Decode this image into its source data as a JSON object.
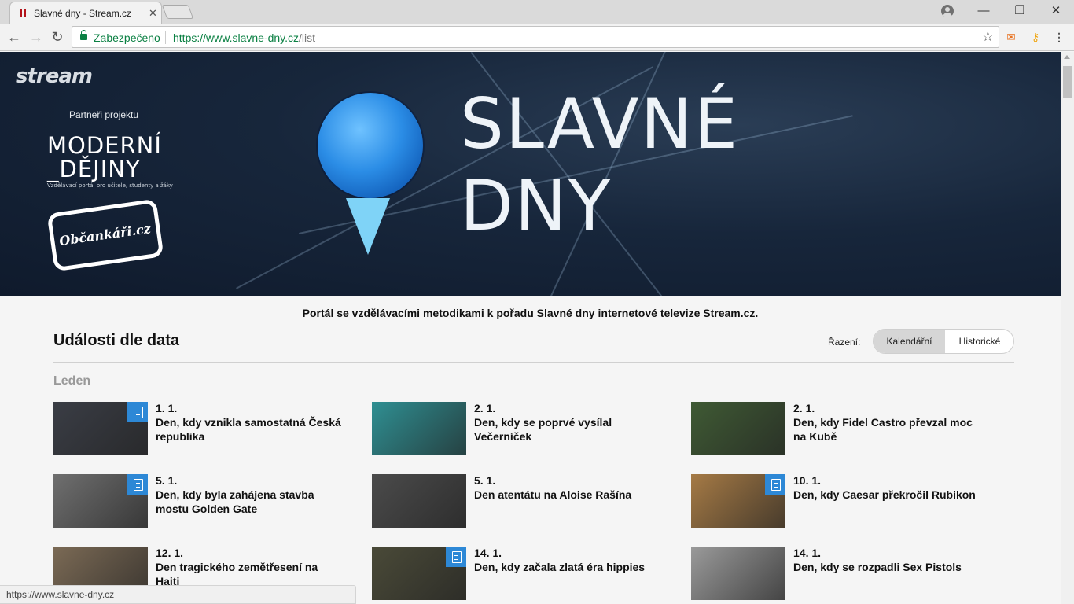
{
  "browser": {
    "tab_title": "Slavné dny - Stream.cz",
    "secure_label": "Zabezpečeno",
    "url_host": "https://www.slavne-dny.cz",
    "url_path": "/list",
    "status_url": "https://www.slavne-dny.cz"
  },
  "hero": {
    "brand": "stream",
    "partners_label": "Partneři projektu",
    "partner1_line1": "MODERNÍ",
    "partner1_line2": "_DĚJINY",
    "partner1_tagline": "Vzdělávací portál pro učitele, studenty a žáky",
    "partner2": "Občankáři.cz",
    "title_line1": "SLAVNÉ",
    "title_line2": "DNY"
  },
  "page": {
    "tagline": "Portál se vzdělávacími metodikami k pořadu Slavné dny internetové televize Stream.cz.",
    "section_title": "Události dle data",
    "sort_label": "Řazení:",
    "sort_options": [
      "Kalendářní",
      "Historické"
    ],
    "sort_active": "Kalendářní",
    "month": "Leden"
  },
  "events": [
    {
      "date": "1. 1.",
      "title": "Den, kdy vznikla samostatná Česká republika",
      "has_doc": true,
      "thumb_color": "#3a3d45"
    },
    {
      "date": "2. 1.",
      "title": "Den, kdy se poprvé vysílal Večerníček",
      "has_doc": false,
      "thumb_color": "#2f8f92"
    },
    {
      "date": "2. 1.",
      "title": "Den, kdy Fidel Castro převzal moc na Kubě",
      "has_doc": false,
      "thumb_color": "#3f5a34"
    },
    {
      "date": "5. 1.",
      "title": "Den, kdy byla zahájena stavba mostu Golden Gate",
      "has_doc": true,
      "thumb_color": "#6f6f6f"
    },
    {
      "date": "5. 1.",
      "title": "Den atentátu na Aloise Rašína",
      "has_doc": false,
      "thumb_color": "#4b4b4b"
    },
    {
      "date": "10. 1.",
      "title": "Den, kdy Caesar překročil Rubikon",
      "has_doc": true,
      "thumb_color": "#a57a45"
    },
    {
      "date": "12. 1.",
      "title": "Den tragického zemětřesení na Haiti",
      "has_doc": false,
      "thumb_color": "#7b6a55"
    },
    {
      "date": "14. 1.",
      "title": "Den, kdy začala zlatá éra hippies",
      "has_doc": true,
      "thumb_color": "#4a4a38"
    },
    {
      "date": "14. 1.",
      "title": "Den, kdy se rozpadli Sex Pistols",
      "has_doc": false,
      "thumb_color": "#9a9a9a"
    }
  ]
}
